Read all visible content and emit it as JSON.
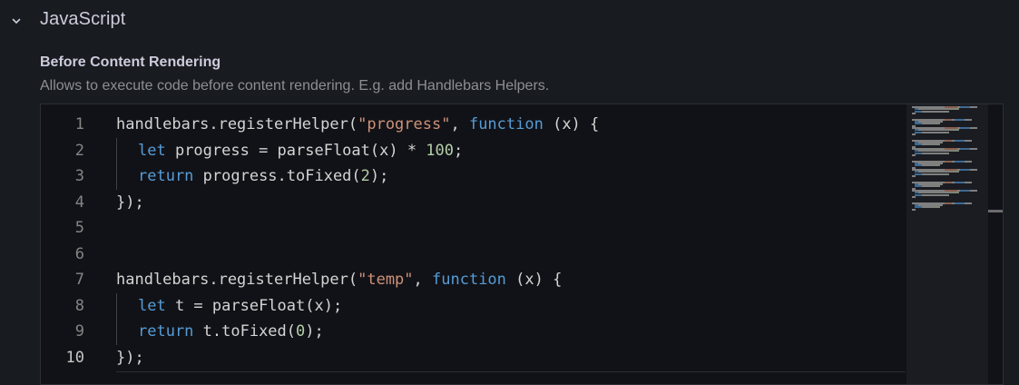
{
  "section": {
    "title": "JavaScript",
    "chevron_icon": "chevron-down-icon"
  },
  "field": {
    "label": "Before Content Rendering",
    "description": "Allows to execute code before content rendering. E.g. add Handlebars Helpers."
  },
  "editor": {
    "line_numbers": [
      "1",
      "2",
      "3",
      "4",
      "5",
      "6",
      "7",
      "8",
      "9",
      "10"
    ],
    "lines": [
      [
        {
          "t": "handlebars.registerHelper(",
          "c": "plain"
        },
        {
          "t": "\"progress\"",
          "c": "str"
        },
        {
          "t": ", ",
          "c": "plain"
        },
        {
          "t": "function",
          "c": "kw"
        },
        {
          "t": " (x) {",
          "c": "plain"
        }
      ],
      [
        {
          "t": "let",
          "c": "kw"
        },
        {
          "t": " progress = parseFloat(x) * ",
          "c": "plain"
        },
        {
          "t": "100",
          "c": "num"
        },
        {
          "t": ";",
          "c": "plain"
        }
      ],
      [
        {
          "t": "return",
          "c": "kw"
        },
        {
          "t": " progress.toFixed(",
          "c": "plain"
        },
        {
          "t": "2",
          "c": "num"
        },
        {
          "t": ");",
          "c": "plain"
        }
      ],
      [
        {
          "t": "});",
          "c": "plain"
        }
      ],
      [],
      [],
      [
        {
          "t": "handlebars.registerHelper(",
          "c": "plain"
        },
        {
          "t": "\"temp\"",
          "c": "str"
        },
        {
          "t": ", ",
          "c": "plain"
        },
        {
          "t": "function",
          "c": "kw"
        },
        {
          "t": " (x) {",
          "c": "plain"
        }
      ],
      [
        {
          "t": "let",
          "c": "kw"
        },
        {
          "t": " t = parseFloat(x);",
          "c": "plain"
        }
      ],
      [
        {
          "t": "return",
          "c": "kw"
        },
        {
          "t": " t.toFixed(",
          "c": "plain"
        },
        {
          "t": "0",
          "c": "num"
        },
        {
          "t": ");",
          "c": "plain"
        }
      ],
      [
        {
          "t": "});",
          "c": "plain"
        }
      ]
    ],
    "indented_lines": [
      1,
      2,
      7,
      8
    ],
    "colors": {
      "plain": "#d4d4d4",
      "string": "#ce9178",
      "keyword": "#569cd6",
      "number": "#b5cea8",
      "line_number": "#858585",
      "background": "#111217"
    }
  }
}
